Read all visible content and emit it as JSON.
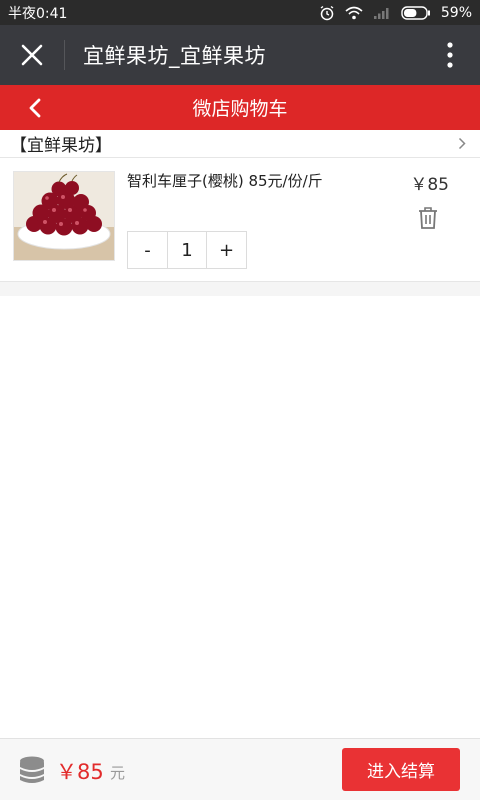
{
  "status_bar": {
    "time": "半夜0:41",
    "battery": "59%",
    "battery_level": 0.59
  },
  "title_bar": {
    "title": "宜鲜果坊_宜鲜果坊",
    "close_icon": "close-icon",
    "more_icon": "more-vertical-icon"
  },
  "header": {
    "title": "微店购物车",
    "back_icon": "chevron-left-icon",
    "accent_color": "#dd2727"
  },
  "shop": {
    "name": "【宜鲜果坊】"
  },
  "cart": {
    "items": [
      {
        "name": "智利车厘子(樱桃) 85元/份/斤",
        "price": "￥85",
        "quantity": "1",
        "minus_label": "-",
        "plus_label": "+",
        "image": "cherries-plate"
      }
    ]
  },
  "footer": {
    "total": "￥85",
    "unit": "元",
    "checkout_label": "进入结算",
    "checkout_color": "#e93234"
  }
}
